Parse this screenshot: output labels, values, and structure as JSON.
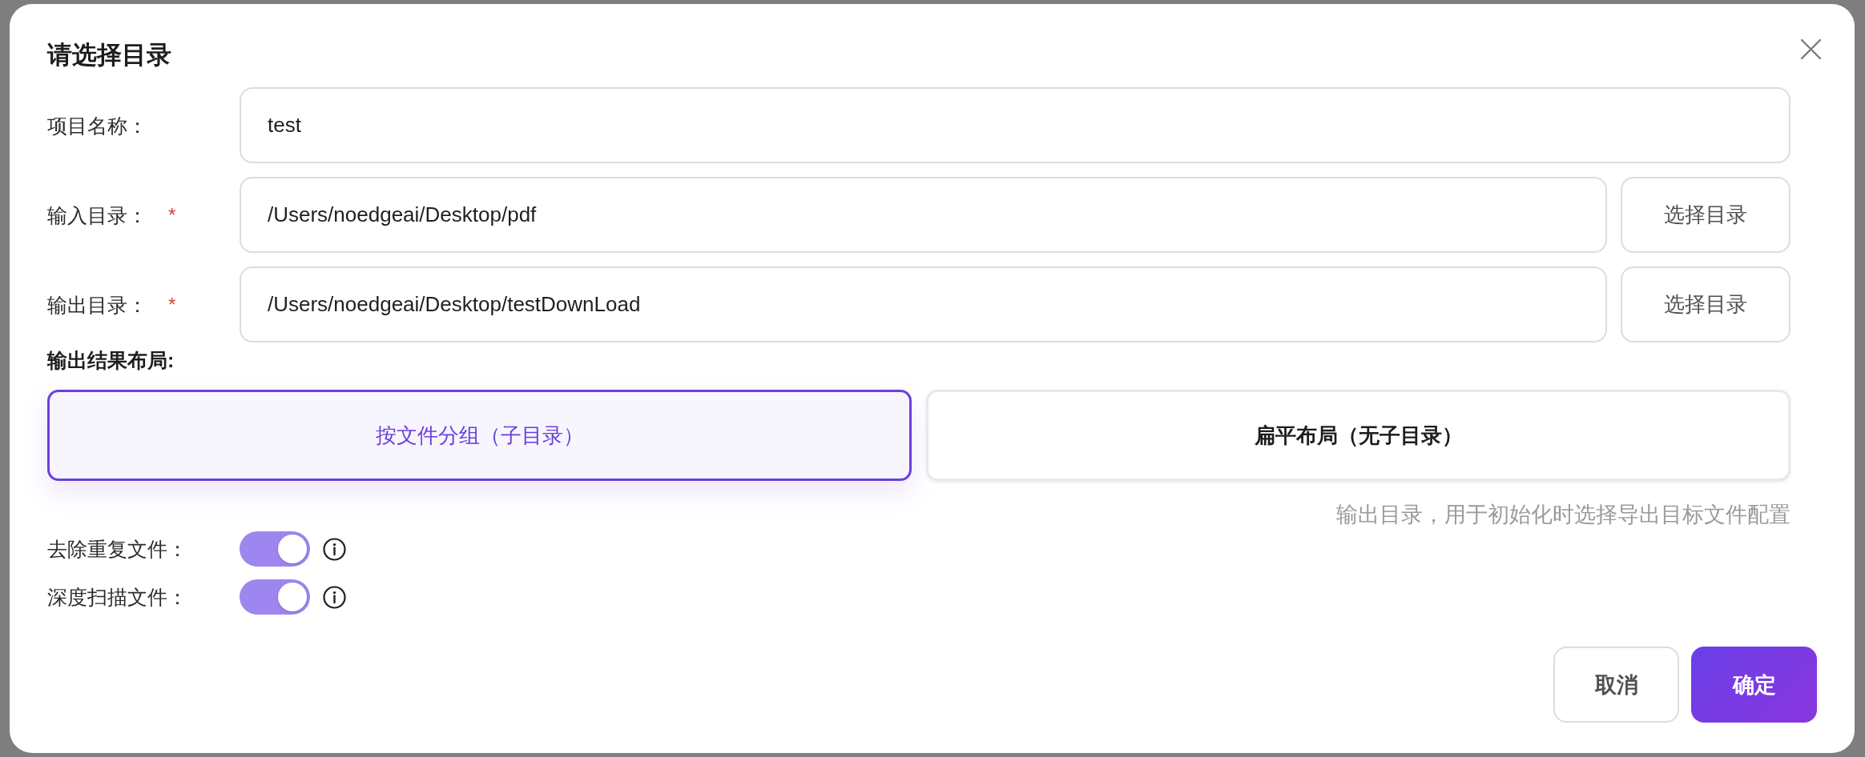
{
  "dialog": {
    "title": "请选择目录",
    "fields": [
      {
        "label": "项目名称：",
        "value": "test"
      },
      {
        "label": "输入目录：",
        "required_mark": "*",
        "value": "/Users/noedgeai/Desktop/pdf",
        "button": "选择目录"
      },
      {
        "label": "输出目录：",
        "required_mark": "*",
        "value": "/Users/noedgeai/Desktop/testDownLoad",
        "button": "选择目录"
      }
    ],
    "layout": {
      "label": "输出结果布局:",
      "options": [
        {
          "label": "按文件分组（子目录）",
          "selected": true
        },
        {
          "label": "扁平布局（无子目录）",
          "selected": false
        }
      ],
      "hint": "输出目录，用于初始化时选择导出目标文件配置"
    },
    "toggles": [
      {
        "label": "去除重复文件：",
        "on": true
      },
      {
        "label": "深度扫描文件：",
        "on": true
      }
    ],
    "buttons": [
      {
        "label": "取消",
        "kind": "secondary"
      },
      {
        "label": "确定",
        "kind": "primary"
      }
    ]
  }
}
